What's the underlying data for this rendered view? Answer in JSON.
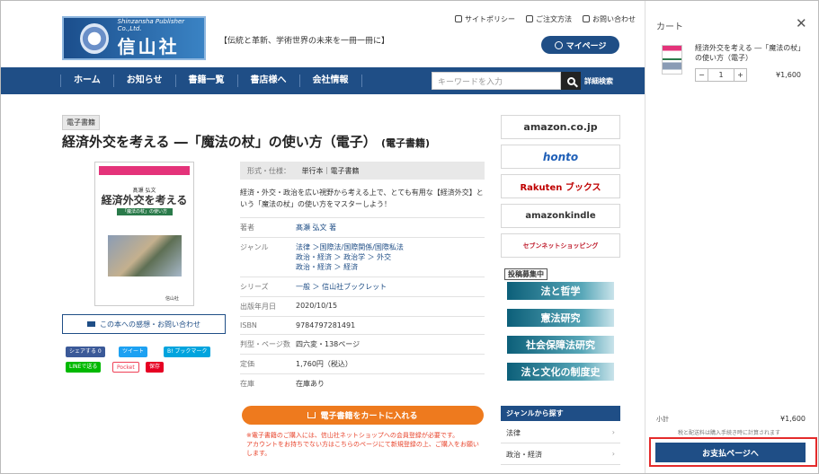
{
  "header": {
    "logo_en": "Shinzansha Publisher Co.,Ltd.",
    "logo_jp": "信山社",
    "tagline": "【伝統と革新、学術世界の未来を一冊一冊に】",
    "toplinks": [
      "サイトポリシー",
      "ご注文方法",
      "お問い合わせ"
    ],
    "mypage": "マイページ"
  },
  "nav": {
    "items": [
      "ホーム",
      "お知らせ",
      "書籍一覧",
      "書店様へ",
      "会社情報"
    ],
    "search_placeholder": "キーワードを入力",
    "advanced_search": "詳細検索"
  },
  "book": {
    "category": "電子書籍",
    "title": "経済外交を考える ―「魔法の杖」の使い方（電子）",
    "title_suffix": "(電子書籍)",
    "cover_small": "髙瀬 弘文",
    "cover_title": "経済外交を考える",
    "cover_band": "「魔法の杖」の使い方",
    "cover_pub": "信山社",
    "inquiry": "この本への感想・お問い合わせ",
    "format_label": "形式・仕様：",
    "format_value": "単行本｜電子書籍",
    "description": "経済・外交・政治を広い視野から考える上で、とても有用な【経済外交】という「魔法の杖」の使い方をマスターしよう！",
    "specs": [
      {
        "k": "著者",
        "v": "髙瀬 弘文 著"
      },
      {
        "k": "ジャンル",
        "v": "法律 ＞国際法/国際関係/国際私法\n政治・経済 ＞ 政治学 ＞ 外交\n政治・経済 ＞ 経済"
      },
      {
        "k": "シリーズ",
        "v": "一般 ＞ 信山社ブックレット"
      },
      {
        "k": "出版年月日",
        "v": "2020/10/15"
      },
      {
        "k": "ISBN",
        "v": "9784797281491"
      },
      {
        "k": "判型・ページ数",
        "v": "四六変・138ページ"
      },
      {
        "k": "定価",
        "v": "1,760円（税込）"
      },
      {
        "k": "在庫",
        "v": "在庫あり"
      }
    ],
    "add_to_cart": "電子書籍をカートに入れる",
    "note": "※電子書籍のご購入には、信山社ネットショップへの会員登録が必要です。\nアカウントをお持ちでない方はこちらのページにて新規登録の上、ご購入をお願いします。"
  },
  "share": {
    "facebook": "シェアする 0",
    "twitter": "ツイート",
    "hatena": "B! ブックマーク",
    "line": "LINEで送る",
    "pocket": "Pocket",
    "save": "保存"
  },
  "shops": [
    "amazon.co.jp",
    "honto",
    "Rakuten ブックス",
    "amazonkindle",
    "セブンネットショッピング"
  ],
  "journals": {
    "cfp": "投稿募集中",
    "items": [
      "法と哲学",
      "憲法研究",
      "社会保障法研究",
      "法と文化の制度史"
    ]
  },
  "genre": {
    "heading": "ジャンルから探す",
    "items": [
      "法律",
      "政治・経済"
    ]
  },
  "cart": {
    "title": "カート",
    "item_title": "経済外交を考える ―「魔法の杖」の使い方（電子）",
    "qty": "1",
    "price": "¥1,600",
    "subtotal_label": "小計",
    "subtotal": "¥1,600",
    "ship_note": "税と配送料は購入手続き時に計算されます",
    "checkout": "お支払ページへ"
  }
}
